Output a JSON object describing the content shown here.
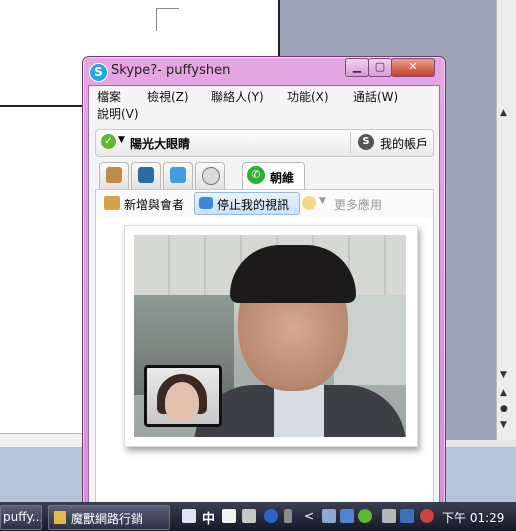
{
  "window": {
    "title": "Skype?- puffyshen",
    "minimize": "▁",
    "maximize": "▢",
    "close": "✕"
  },
  "menu": {
    "items": [
      "檔案",
      "檢視(Z)",
      "聯絡人(Y)",
      "功能(X)",
      "通話(W)"
    ],
    "help": "說明(V)"
  },
  "status": {
    "name": "陽光大眼睛",
    "account_label": "我的帳戶"
  },
  "tabs": {
    "active_label": "朝維"
  },
  "toolbar": {
    "add_label": "新增與會者",
    "stop_video_label": "停止我的視訊",
    "more_label": "更多應用"
  },
  "taskbar": {
    "item1_label": "puffy...",
    "item2_label": "魔獸網路行銷",
    "ime_label": "中",
    "clock": "下午 01:29"
  },
  "colors": {
    "window_frame": "#da8fd8",
    "taskbar": "#151927",
    "skype_blue": "#27a4e7",
    "online_green": "#5cb82e"
  }
}
